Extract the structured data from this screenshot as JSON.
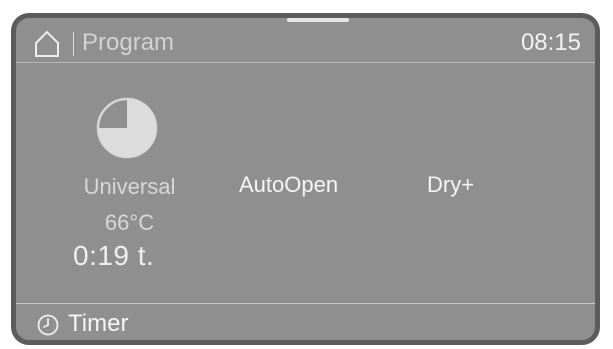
{
  "header": {
    "title": "Program",
    "time": "08:15",
    "home_icon": "home-icon"
  },
  "program": {
    "name": "Universal",
    "temperature": "66°C",
    "duration": "0:19 t.",
    "progress_icon": "pie-progress-icon",
    "progress_fraction": 0.75
  },
  "options": [
    {
      "label": "AutoOpen"
    },
    {
      "label": "Dry+"
    }
  ],
  "footer": {
    "timer_label": "Timer",
    "timer_icon": "clock-icon"
  },
  "colors": {
    "screen_bg": "#8f8f8f",
    "bezel": "#5c5c5c",
    "text_bright": "#f5f5f5",
    "text_dim": "#d2d2d2"
  }
}
